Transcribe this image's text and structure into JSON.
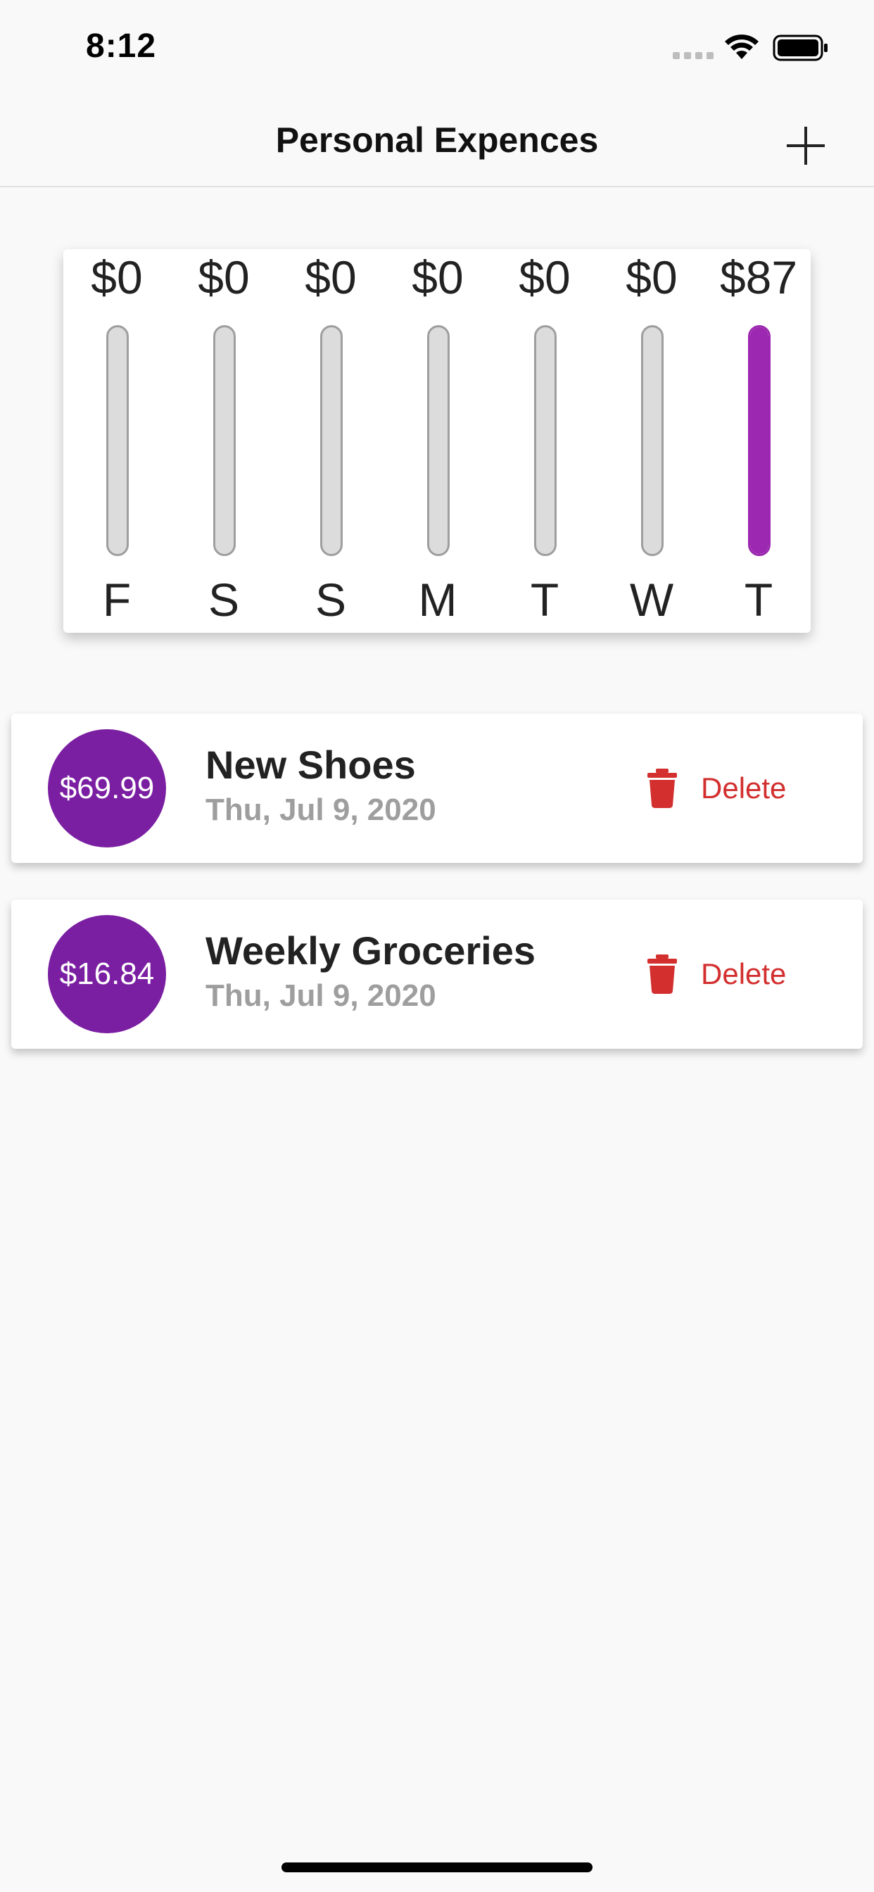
{
  "status_bar": {
    "time": "8:12"
  },
  "app_bar": {
    "title": "Personal Expences",
    "add_icon": "plus-icon"
  },
  "chart_data": {
    "type": "bar",
    "categories": [
      "F",
      "S",
      "S",
      "M",
      "T",
      "W",
      "T"
    ],
    "value_labels": [
      "$0",
      "$0",
      "$0",
      "$0",
      "$0",
      "$0",
      "$87"
    ],
    "values": [
      0,
      0,
      0,
      0,
      0,
      0,
      86.83
    ],
    "fill_fraction": [
      0,
      0,
      0,
      0,
      0,
      0,
      1.0
    ],
    "colors": {
      "fill": "#9c27b0",
      "track": "#dcdcdc",
      "track_border": "#9e9e9e"
    }
  },
  "transactions": [
    {
      "amount": "$69.99",
      "title": "New Shoes",
      "date": "Thu, Jul 9, 2020",
      "delete_label": "Delete"
    },
    {
      "amount": "$16.84",
      "title": "Weekly Groceries",
      "date": "Thu, Jul 9, 2020",
      "delete_label": "Delete"
    }
  ],
  "colors": {
    "accent": "#7b1fa2",
    "danger": "#d32f2f"
  }
}
